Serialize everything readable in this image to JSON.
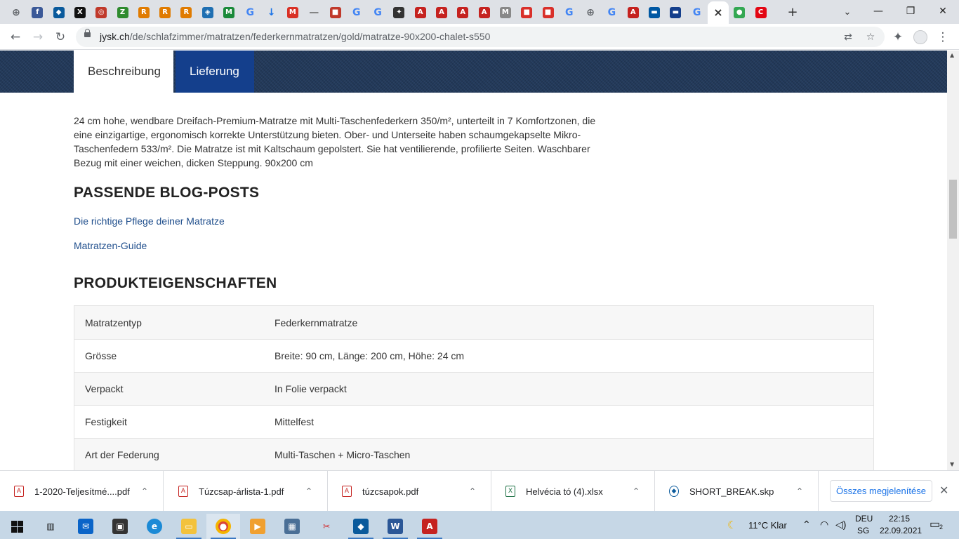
{
  "browser": {
    "tabs": [
      {
        "icon": "globe-icon",
        "color": "#5f6368",
        "glyph": "⊕"
      },
      {
        "icon": "f-icon",
        "color": "#3b5998",
        "glyph": "f"
      },
      {
        "icon": "box-icon",
        "color": "#0a5a9c",
        "glyph": "◆"
      },
      {
        "icon": "x-icon",
        "color": "#111111",
        "glyph": "X"
      },
      {
        "icon": "flag-icon",
        "color": "#c0392b",
        "glyph": "◎"
      },
      {
        "icon": "leaf-icon",
        "color": "#2e8b2e",
        "glyph": "Z"
      },
      {
        "icon": "r-icon",
        "color": "#e07b00",
        "glyph": "R"
      },
      {
        "icon": "r-icon",
        "color": "#e07b00",
        "glyph": "R"
      },
      {
        "icon": "r-icon",
        "color": "#e07b00",
        "glyph": "R"
      },
      {
        "icon": "shield-icon",
        "color": "#1f6fb2",
        "glyph": "◈"
      },
      {
        "icon": "mn-icon",
        "color": "#1a8a3a",
        "glyph": "M"
      },
      {
        "icon": "google-icon",
        "color": "#4285f4",
        "glyph": "G"
      },
      {
        "icon": "download-icon",
        "color": "#1a73e8",
        "glyph": "↓"
      },
      {
        "icon": "gmail-icon",
        "color": "#d93025",
        "glyph": "M"
      },
      {
        "icon": "line-icon",
        "color": "#777777",
        "glyph": "—"
      },
      {
        "icon": "crest-icon",
        "color": "#c0392b",
        "glyph": "■"
      },
      {
        "icon": "google-icon",
        "color": "#4285f4",
        "glyph": "G"
      },
      {
        "icon": "google-icon",
        "color": "#4285f4",
        "glyph": "G"
      },
      {
        "icon": "puzzle-icon",
        "color": "#333333",
        "glyph": "✦"
      },
      {
        "icon": "pdf-icon",
        "color": "#c5221f",
        "glyph": "A"
      },
      {
        "icon": "pdf-icon",
        "color": "#c5221f",
        "glyph": "A"
      },
      {
        "icon": "pdf-icon",
        "color": "#c5221f",
        "glyph": "A"
      },
      {
        "icon": "pdf-icon",
        "color": "#c5221f",
        "glyph": "A"
      },
      {
        "icon": "mk-icon",
        "color": "#888888",
        "glyph": "M"
      },
      {
        "icon": "red-doc-icon",
        "color": "#d9302a",
        "glyph": "■"
      },
      {
        "icon": "red-doc-icon",
        "color": "#d9302a",
        "glyph": "■"
      },
      {
        "icon": "google-icon",
        "color": "#4285f4",
        "glyph": "G"
      },
      {
        "icon": "globe-icon",
        "color": "#5f6368",
        "glyph": "⊕"
      },
      {
        "icon": "google-icon",
        "color": "#4285f4",
        "glyph": "G"
      },
      {
        "icon": "pdf-icon",
        "color": "#c5221f",
        "glyph": "A"
      },
      {
        "icon": "ikea-icon",
        "color": "#0058a3",
        "glyph": "▬"
      },
      {
        "icon": "jysk-icon",
        "color": "#143f8c",
        "glyph": "▬"
      },
      {
        "icon": "google-icon",
        "color": "#4285f4",
        "glyph": "G"
      },
      {
        "icon": "close-icon",
        "color": "#333333",
        "glyph": "×"
      },
      {
        "icon": "maps-icon",
        "color": "#34a853",
        "glyph": "●"
      },
      {
        "icon": "conforama-icon",
        "color": "#e30613",
        "glyph": "C"
      }
    ],
    "url_host": "jysk.ch",
    "url_path": "/de/schlafzimmer/matratzen/federkernmatratzen/gold/matratze-90x200-chalet-s550"
  },
  "page": {
    "tabs": [
      "Beschreibung",
      "Lieferung"
    ],
    "description": "24 cm hohe, wendbare Dreifach-Premium-Matratze mit Multi-Taschenfederkern 350/m², unterteilt in 7 Komfortzonen, die eine einzigartige, ergonomisch korrekte Unterstützung bieten. Ober- und Unterseite haben schaumgekapselte Mikro-Taschenfedern 533/m². Die Matratze ist mit Kaltschaum gepolstert. Sie hat ventilierende, profilierte Seiten. Waschbarer Bezug mit einer weichen, dicken Steppung. 90x200 cm",
    "blog_heading": "PASSENDE BLOG-POSTS",
    "blog_links": [
      "Die richtige Pflege deiner Matratze",
      "Matratzen-Guide"
    ],
    "props_heading": "PRODUKTEIGENSCHAFTEN",
    "properties": [
      {
        "key": "Matratzentyp",
        "value": "Federkernmatratze"
      },
      {
        "key": "Grösse",
        "value": "Breite: 90 cm, Länge: 200 cm, Höhe: 24 cm"
      },
      {
        "key": "Verpackt",
        "value": "In Folie verpackt"
      },
      {
        "key": "Festigkeit",
        "value": "Mittelfest"
      },
      {
        "key": "Art der Federung",
        "value": "Multi-Taschen + Micro-Taschen"
      }
    ]
  },
  "downloads": {
    "items": [
      {
        "name": "1-2020-Teljesítmé....pdf",
        "type": "pdf"
      },
      {
        "name": "Túzcsap-árlista-1.pdf",
        "type": "pdf"
      },
      {
        "name": "túzcsapok.pdf",
        "type": "pdf"
      },
      {
        "name": "Helvécia tó (4).xlsx",
        "type": "xls"
      },
      {
        "name": "SHORT_BREAK.skp",
        "type": "skp"
      }
    ],
    "show_all": "Összes megjelenítése"
  },
  "taskbar": {
    "weather": "11°C  Klar",
    "lang_1": "DEU",
    "lang_2": "SG",
    "time": "22:15",
    "date": "22.09.2021",
    "notifications": "2"
  }
}
